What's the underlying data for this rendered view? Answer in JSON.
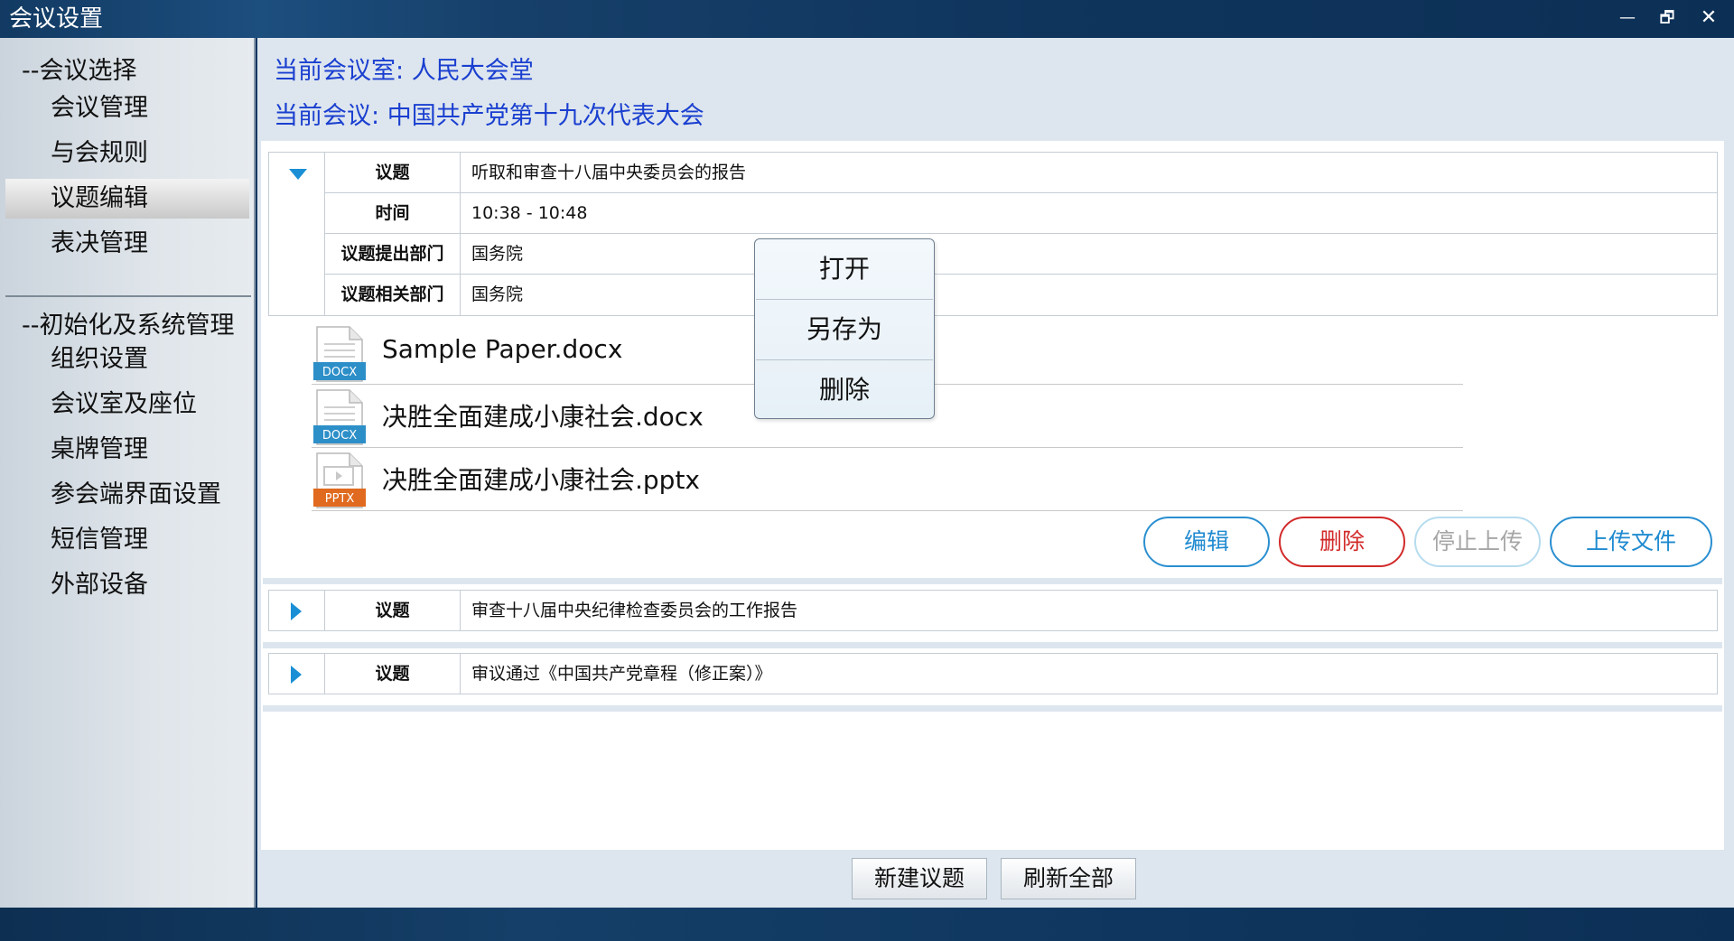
{
  "window": {
    "title": "会议设置",
    "minimize": "—",
    "maximize": "🗗",
    "close": "✕"
  },
  "sidebar": {
    "section1": "--会议选择",
    "section1_items": [
      "会议管理",
      "与会规则",
      "议题编辑",
      "表决管理"
    ],
    "active_item": "议题编辑",
    "section2": "--初始化及系统管理",
    "section2_items": [
      "组织设置",
      "会议室及座位",
      "桌牌管理",
      "参会端界面设置",
      "短信管理",
      "外部设备"
    ]
  },
  "header": {
    "room_label": "当前会议室:",
    "room_value": "人民大会堂",
    "meeting_label": "当前会议:",
    "meeting_value": "中国共产党第十九次代表大会"
  },
  "agenda1": {
    "rows": [
      {
        "label": "议题",
        "value": "听取和审查十八届中央委员会的报告"
      },
      {
        "label": "时间",
        "value": "10:38 - 10:48"
      },
      {
        "label": "议题提出部门",
        "value": "国务院"
      },
      {
        "label": "议题相关部门",
        "value": "国务院"
      }
    ],
    "files": [
      {
        "name": "Sample Paper.docx",
        "ext": "DOCX"
      },
      {
        "name": "决胜全面建成小康社会.docx",
        "ext": "DOCX"
      },
      {
        "name": "决胜全面建成小康社会.pptx",
        "ext": "PPTX"
      }
    ],
    "actions": {
      "edit": "编辑",
      "delete": "删除",
      "stop_upload": "停止上传",
      "upload": "上传文件"
    }
  },
  "agenda2": {
    "label": "议题",
    "value": "审查十八届中央纪律检查委员会的工作报告"
  },
  "agenda3": {
    "label": "议题",
    "value": "审议通过《中国共产党章程（修正案）》"
  },
  "context_menu": {
    "open": "打开",
    "save_as": "另存为",
    "delete": "删除"
  },
  "footer": {
    "new_agenda": "新建议题",
    "refresh_all": "刷新全部"
  },
  "colors": {
    "accent_blue": "#1f8ad0",
    "danger_red": "#d22a2a",
    "header_text_blue": "#1a3fd0",
    "docx_icon": "#2d8fc8",
    "pptx_icon": "#e06a1f"
  }
}
